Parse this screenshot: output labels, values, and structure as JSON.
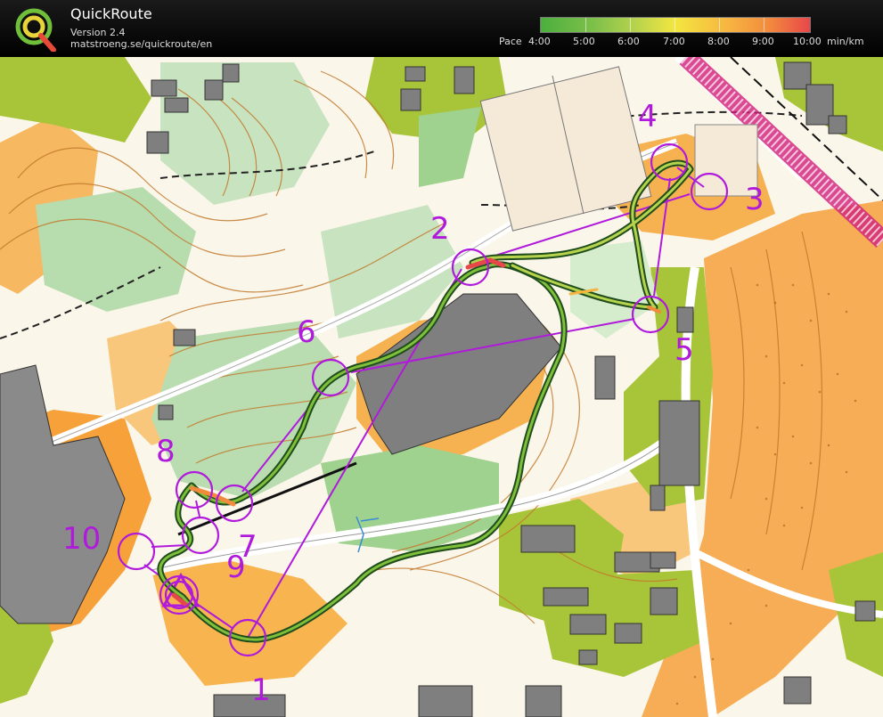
{
  "app": {
    "title": "QuickRoute",
    "version": "Version 2.4",
    "url": "matstroeng.se/quickroute/en"
  },
  "pace_scale": {
    "label": "Pace",
    "ticks": [
      "4:00",
      "5:00",
      "6:00",
      "7:00",
      "8:00",
      "9:00",
      "10:00"
    ],
    "unit": "min/km"
  },
  "controls": [
    "1",
    "2",
    "3",
    "4",
    "5",
    "6",
    "7",
    "8",
    "9",
    "10"
  ],
  "colors": {
    "course": "#b01adb",
    "route_track": "#2e6b2b",
    "map_green": "#a8c53a",
    "map_open": "#f6a13a",
    "building": "#7f7f7f",
    "contour": "#c27a2d"
  }
}
